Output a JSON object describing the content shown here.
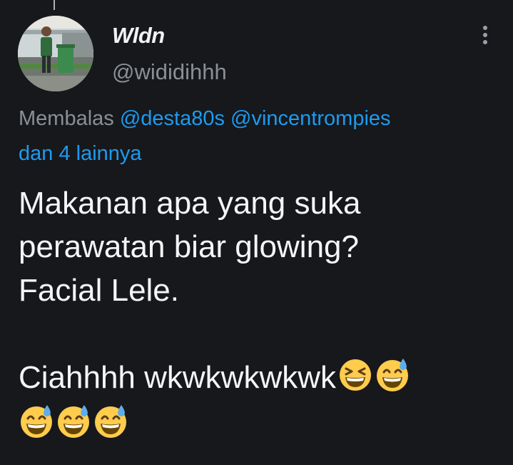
{
  "tweet": {
    "display_name": "Wldn",
    "handle": "@wididihhh",
    "reply_prefix": "Membalas",
    "mentions": [
      "@desta80s",
      "@vincentrompies"
    ],
    "reply_suffix": "dan 4 lainnya",
    "text_lines": [
      "Makanan apa yang suka",
      "perawatan biar glowing?",
      "Facial Lele.",
      "Ciahhhh wkwkwkwkwk"
    ],
    "emojis_line4": [
      "grinning-squinting-face",
      "grinning-face-with-sweat"
    ],
    "emojis_line5": [
      "grinning-face-with-sweat",
      "grinning-face-with-sweat",
      "grinning-face-with-sweat"
    ]
  },
  "icons": {
    "more": "more-vertical-icon"
  },
  "colors": {
    "background": "#16181c",
    "link": "#1d9bf0",
    "secondary_text": "#8b9096",
    "primary_text": "#e7e9ea",
    "emoji_yellow": "#ffcc4d",
    "sweat_drop": "#5dadec"
  }
}
